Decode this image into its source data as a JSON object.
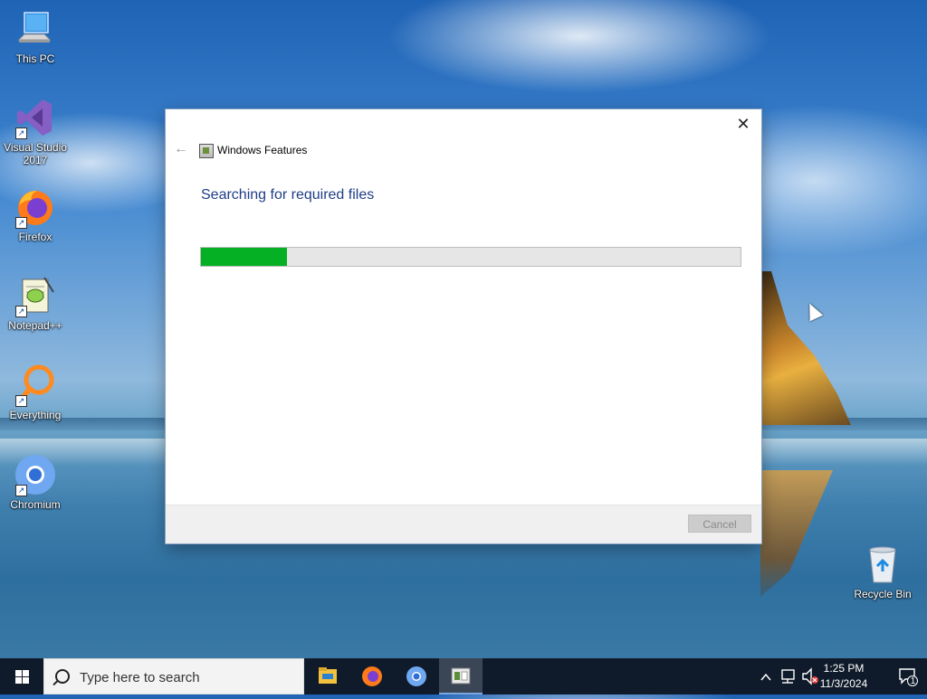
{
  "desktop": {
    "icons": [
      {
        "label": "This PC"
      },
      {
        "label": "Visual Studio 2017"
      },
      {
        "label": "Firefox"
      },
      {
        "label": "Notepad++"
      },
      {
        "label": "Everything"
      },
      {
        "label": "Chromium"
      },
      {
        "label": "Recycle Bin"
      }
    ]
  },
  "dialog": {
    "title": "Windows Features",
    "heading": "Searching for required files",
    "progress": 0.16,
    "cancel_label": "Cancel",
    "close_glyph": "✕",
    "back_glyph": "←"
  },
  "taskbar": {
    "search_placeholder": "Type here to search",
    "apps": [
      {
        "icon": "file-explorer-icon"
      },
      {
        "icon": "firefox-icon"
      },
      {
        "icon": "chromium-icon"
      },
      {
        "icon": "windows-features-icon",
        "active": true
      }
    ],
    "clock": {
      "time": "1:25 PM",
      "date": "11/3/2024"
    },
    "notification_count": "1"
  },
  "colors": {
    "progress_fill": "#06b025",
    "heading": "#1e3d87",
    "taskbar": "#0f1b2a"
  }
}
